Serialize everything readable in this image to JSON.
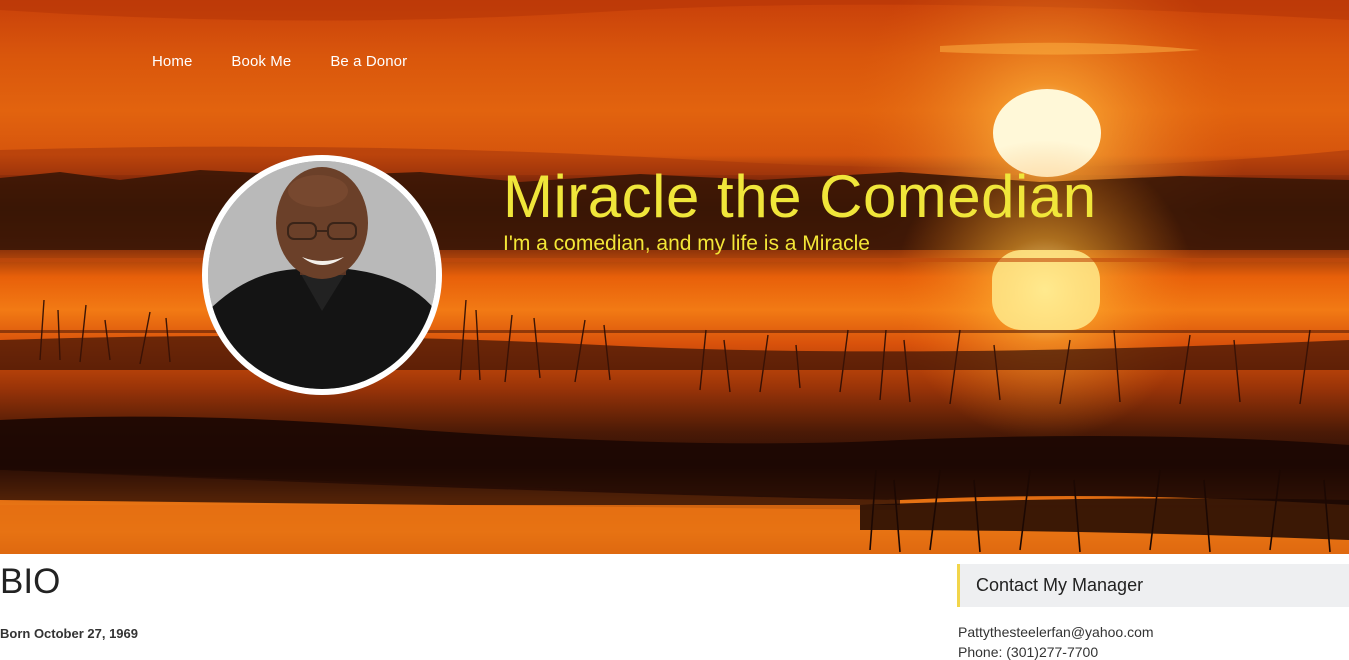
{
  "nav": {
    "items": [
      {
        "label": "Home"
      },
      {
        "label": "Book Me"
      },
      {
        "label": "Be a Donor"
      }
    ]
  },
  "hero": {
    "title": "Miracle the Comedian",
    "tagline": "I'm a comedian, and my life is a Miracle"
  },
  "bio": {
    "heading": "BIO",
    "born": "Born October 27, 1969"
  },
  "sidebar": {
    "contact_heading": "Contact My Manager",
    "email": "Pattythesteelerfan@yahoo.com",
    "phone": "Phone: (301)277-7700"
  },
  "colors": {
    "title": "#f0e63a",
    "accent_border": "#f2d54a",
    "sidebar_bg": "#eeeff1"
  }
}
